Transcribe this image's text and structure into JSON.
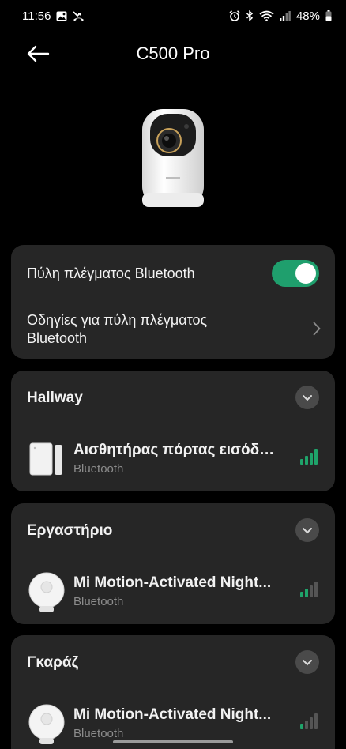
{
  "status_bar": {
    "time": "11:56",
    "battery": "48%"
  },
  "header": {
    "title": "C500 Pro",
    "back_icon": "arrow-left-icon"
  },
  "gateway_card": {
    "toggle_label": "Πύλη πλέγματος Bluetooth",
    "toggle_on": true,
    "guide_label_line1": "Οδηγίες για πύλη πλέγματος",
    "guide_label_line2": "Bluetooth"
  },
  "rooms": [
    {
      "name": "Hallway",
      "device": {
        "name": "Αισθητήρας πόρτας εισόδο...",
        "protocol": "Bluetooth",
        "signal_bars_filled": 4
      }
    },
    {
      "name": "Εργαστήριο",
      "device": {
        "name": "Mi Motion-Activated Night...",
        "protocol": "Bluetooth",
        "signal_bars_filled": 2
      }
    },
    {
      "name": "Γκαράζ",
      "device": {
        "name": "Mi Motion-Activated Night...",
        "protocol": "Bluetooth",
        "signal_bars_filled": 1
      }
    }
  ],
  "colors": {
    "background": "#000000",
    "card": "#262626",
    "accent_green": "#1f9f6d",
    "signal_green": "#1fa36a",
    "signal_gray": "#555555"
  }
}
